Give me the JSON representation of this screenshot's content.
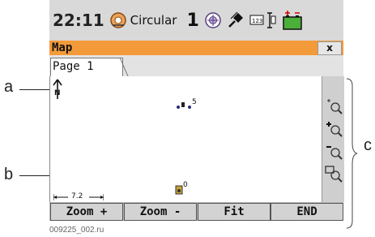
{
  "annotations": {
    "a": "a",
    "b": "b",
    "c": "c"
  },
  "status": {
    "time": "22:11",
    "mode": "Circular",
    "count": "1"
  },
  "window": {
    "title": "Map",
    "close": "x"
  },
  "tabs": [
    {
      "label": "Page 1"
    }
  ],
  "map": {
    "points": [
      {
        "label": "5"
      },
      {
        "label": "0"
      }
    ],
    "scale": "7.2"
  },
  "softkeys": [
    {
      "label": "Zoom +"
    },
    {
      "label": "Zoom -"
    },
    {
      "label": "Fit"
    },
    {
      "label": "END"
    }
  ],
  "caption": "009225_002.ru",
  "colors": {
    "titlebar": "#f39a3a",
    "statusbar": "#d9d9d9",
    "toolstrip": "#cfcfcf"
  }
}
